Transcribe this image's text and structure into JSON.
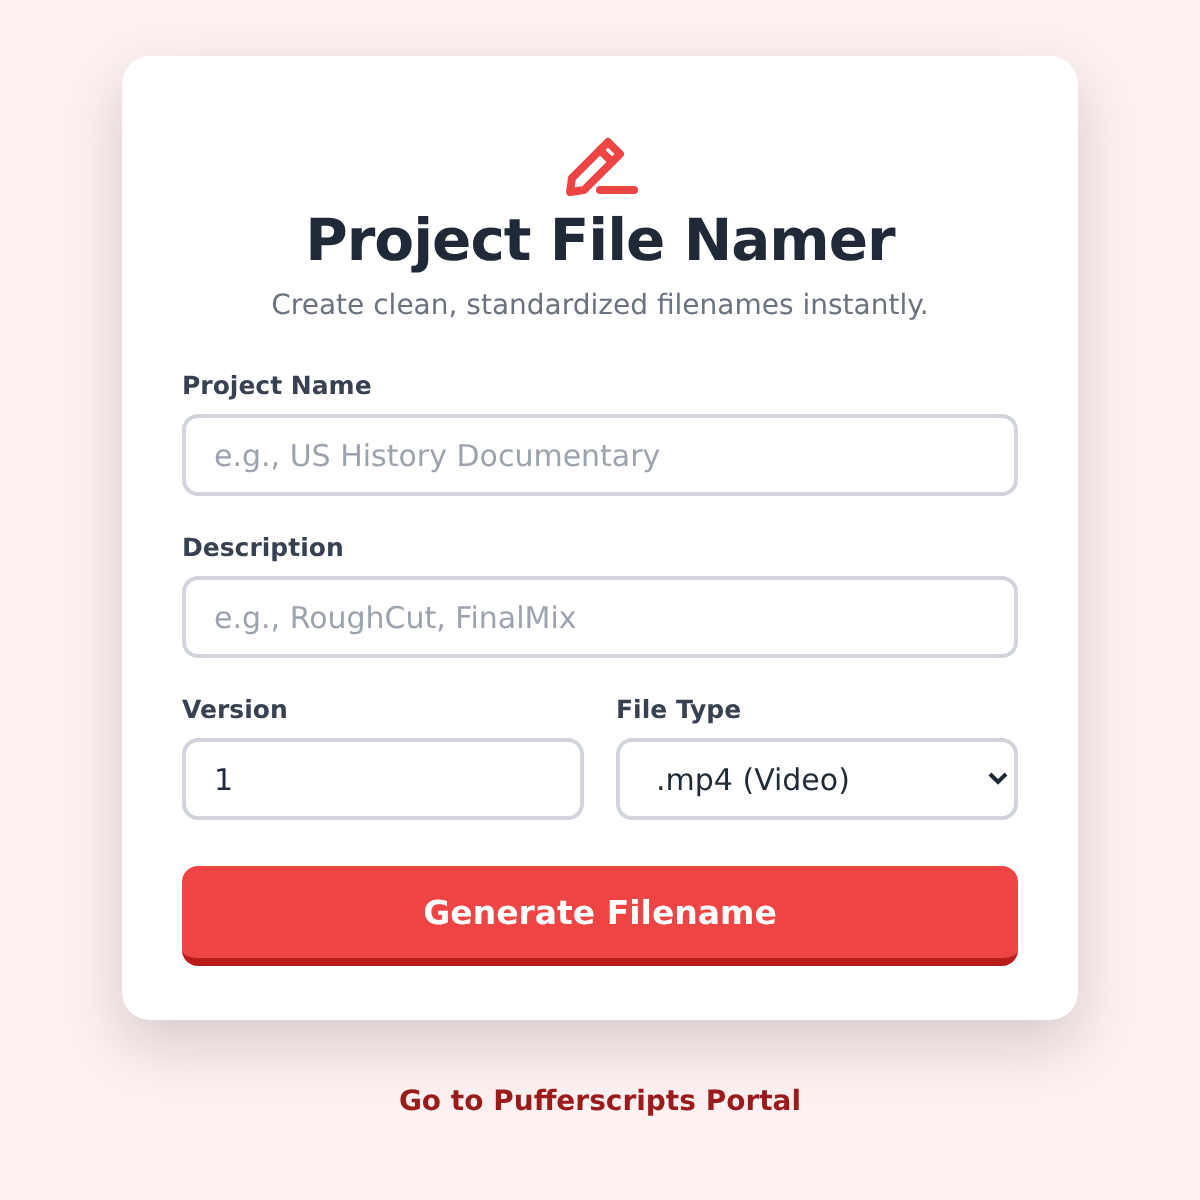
{
  "header": {
    "title": "Project File Namer",
    "subtitle": "Create clean, standardized filenames instantly."
  },
  "fields": [
    {
      "label": "Project Name",
      "placeholder": "e.g., US History Documentary"
    },
    {
      "label": "Description",
      "placeholder": "e.g., RoughCut, FinalMix"
    }
  ],
  "version": {
    "label": "Version",
    "value": "1"
  },
  "file_type": {
    "label": "File Type",
    "value": ".mp4 (Video)"
  },
  "button": "Generate Filename",
  "footer_link": "Go to Pufferscripts Portal"
}
